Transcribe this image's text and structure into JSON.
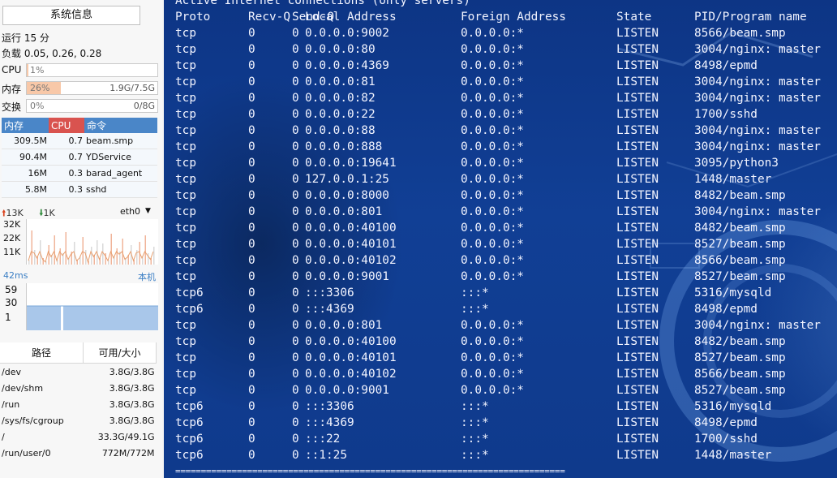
{
  "sidebar": {
    "title_button": "系统信息",
    "uptime": "运行 15 分",
    "load": "负载 0.05, 0.26, 0.28",
    "cpu": {
      "label": "CPU",
      "percent_text": "1%",
      "fill": 0.01,
      "amount": ""
    },
    "mem": {
      "label": "内存",
      "percent_text": "26%",
      "fill": 0.26,
      "amount": "1.9G/7.5G"
    },
    "swap": {
      "label": "交换",
      "percent_text": "0%",
      "fill": 0.0,
      "amount": "0/8G"
    },
    "proc_headers": {
      "mem": "内存",
      "cpu": "CPU",
      "cmd": "命令"
    },
    "processes": [
      {
        "mem": "309.5M",
        "cpu": "0.7",
        "cmd": "beam.smp"
      },
      {
        "mem": "90.4M",
        "cpu": "0.7",
        "cmd": "YDService"
      },
      {
        "mem": "16M",
        "cpu": "0.3",
        "cmd": "barad_agent"
      },
      {
        "mem": "5.8M",
        "cpu": "0.3",
        "cmd": "sshd"
      }
    ],
    "net": {
      "up": "13K",
      "down": "1K",
      "iface": "eth0",
      "y_labels": [
        "32K",
        "22K",
        "11K"
      ]
    },
    "ping": {
      "latency": "42ms",
      "host": "本机",
      "y_labels": [
        "59",
        "30",
        "1"
      ]
    },
    "disk_headers": {
      "path": "路径",
      "size": "可用/大小"
    },
    "disks": [
      {
        "path": "/dev",
        "size": "3.8G/3.8G"
      },
      {
        "path": "/dev/shm",
        "size": "3.8G/3.8G"
      },
      {
        "path": "/run",
        "size": "3.8G/3.8G"
      },
      {
        "path": "/sys/fs/cgroup",
        "size": "3.8G/3.8G"
      },
      {
        "path": "/",
        "size": "33.3G/49.1G"
      },
      {
        "path": "/run/user/0",
        "size": "772M/772M"
      }
    ]
  },
  "terminal": {
    "banner": "Active Internet connections (only servers)",
    "headers": {
      "proto": "Proto",
      "recvq": "Recv-Q",
      "sendq": "Send-Q",
      "local": "Local Address",
      "foreign": "Foreign Address",
      "state": "State",
      "pid": "PID/Program name"
    },
    "rows": [
      {
        "proto": "tcp",
        "recvq": "0",
        "sendq": "0",
        "local": "0.0.0.0:9002",
        "foreign": "0.0.0.0:*",
        "state": "LISTEN",
        "pid": "8566/beam.smp"
      },
      {
        "proto": "tcp",
        "recvq": "0",
        "sendq": "0",
        "local": "0.0.0.0:80",
        "foreign": "0.0.0.0:*",
        "state": "LISTEN",
        "pid": "3004/nginx: master"
      },
      {
        "proto": "tcp",
        "recvq": "0",
        "sendq": "0",
        "local": "0.0.0.0:4369",
        "foreign": "0.0.0.0:*",
        "state": "LISTEN",
        "pid": "8498/epmd"
      },
      {
        "proto": "tcp",
        "recvq": "0",
        "sendq": "0",
        "local": "0.0.0.0:81",
        "foreign": "0.0.0.0:*",
        "state": "LISTEN",
        "pid": "3004/nginx: master"
      },
      {
        "proto": "tcp",
        "recvq": "0",
        "sendq": "0",
        "local": "0.0.0.0:82",
        "foreign": "0.0.0.0:*",
        "state": "LISTEN",
        "pid": "3004/nginx: master"
      },
      {
        "proto": "tcp",
        "recvq": "0",
        "sendq": "0",
        "local": "0.0.0.0:22",
        "foreign": "0.0.0.0:*",
        "state": "LISTEN",
        "pid": "1700/sshd"
      },
      {
        "proto": "tcp",
        "recvq": "0",
        "sendq": "0",
        "local": "0.0.0.0:88",
        "foreign": "0.0.0.0:*",
        "state": "LISTEN",
        "pid": "3004/nginx: master"
      },
      {
        "proto": "tcp",
        "recvq": "0",
        "sendq": "0",
        "local": "0.0.0.0:888",
        "foreign": "0.0.0.0:*",
        "state": "LISTEN",
        "pid": "3004/nginx: master"
      },
      {
        "proto": "tcp",
        "recvq": "0",
        "sendq": "0",
        "local": "0.0.0.0:19641",
        "foreign": "0.0.0.0:*",
        "state": "LISTEN",
        "pid": "3095/python3"
      },
      {
        "proto": "tcp",
        "recvq": "0",
        "sendq": "0",
        "local": "127.0.0.1:25",
        "foreign": "0.0.0.0:*",
        "state": "LISTEN",
        "pid": "1448/master"
      },
      {
        "proto": "tcp",
        "recvq": "0",
        "sendq": "0",
        "local": "0.0.0.0:8000",
        "foreign": "0.0.0.0:*",
        "state": "LISTEN",
        "pid": "8482/beam.smp"
      },
      {
        "proto": "tcp",
        "recvq": "0",
        "sendq": "0",
        "local": "0.0.0.0:801",
        "foreign": "0.0.0.0:*",
        "state": "LISTEN",
        "pid": "3004/nginx: master"
      },
      {
        "proto": "tcp",
        "recvq": "0",
        "sendq": "0",
        "local": "0.0.0.0:40100",
        "foreign": "0.0.0.0:*",
        "state": "LISTEN",
        "pid": "8482/beam.smp"
      },
      {
        "proto": "tcp",
        "recvq": "0",
        "sendq": "0",
        "local": "0.0.0.0:40101",
        "foreign": "0.0.0.0:*",
        "state": "LISTEN",
        "pid": "8527/beam.smp"
      },
      {
        "proto": "tcp",
        "recvq": "0",
        "sendq": "0",
        "local": "0.0.0.0:40102",
        "foreign": "0.0.0.0:*",
        "state": "LISTEN",
        "pid": "8566/beam.smp"
      },
      {
        "proto": "tcp",
        "recvq": "0",
        "sendq": "0",
        "local": "0.0.0.0:9001",
        "foreign": "0.0.0.0:*",
        "state": "LISTEN",
        "pid": "8527/beam.smp"
      },
      {
        "proto": "tcp6",
        "recvq": "0",
        "sendq": "0",
        "local": ":::3306",
        "foreign": ":::*",
        "state": "LISTEN",
        "pid": "5316/mysqld"
      },
      {
        "proto": "tcp6",
        "recvq": "0",
        "sendq": "0",
        "local": ":::4369",
        "foreign": ":::*",
        "state": "LISTEN",
        "pid": "8498/epmd"
      },
      {
        "proto": "tcp",
        "recvq": "0",
        "sendq": "0",
        "local": "0.0.0.0:801",
        "foreign": "0.0.0.0:*",
        "state": "LISTEN",
        "pid": "3004/nginx: master"
      },
      {
        "proto": "tcp",
        "recvq": "0",
        "sendq": "0",
        "local": "0.0.0.0:40100",
        "foreign": "0.0.0.0:*",
        "state": "LISTEN",
        "pid": "8482/beam.smp"
      },
      {
        "proto": "tcp",
        "recvq": "0",
        "sendq": "0",
        "local": "0.0.0.0:40101",
        "foreign": "0.0.0.0:*",
        "state": "LISTEN",
        "pid": "8527/beam.smp"
      },
      {
        "proto": "tcp",
        "recvq": "0",
        "sendq": "0",
        "local": "0.0.0.0:40102",
        "foreign": "0.0.0.0:*",
        "state": "LISTEN",
        "pid": "8566/beam.smp"
      },
      {
        "proto": "tcp",
        "recvq": "0",
        "sendq": "0",
        "local": "0.0.0.0:9001",
        "foreign": "0.0.0.0:*",
        "state": "LISTEN",
        "pid": "8527/beam.smp"
      },
      {
        "proto": "tcp6",
        "recvq": "0",
        "sendq": "0",
        "local": ":::3306",
        "foreign": ":::*",
        "state": "LISTEN",
        "pid": "5316/mysqld"
      },
      {
        "proto": "tcp6",
        "recvq": "0",
        "sendq": "0",
        "local": ":::4369",
        "foreign": ":::*",
        "state": "LISTEN",
        "pid": "8498/epmd"
      },
      {
        "proto": "tcp6",
        "recvq": "0",
        "sendq": "0",
        "local": ":::22",
        "foreign": ":::*",
        "state": "LISTEN",
        "pid": "1700/sshd"
      },
      {
        "proto": "tcp6",
        "recvq": "0",
        "sendq": "0",
        "local": "::1:25",
        "foreign": ":::*",
        "state": "LISTEN",
        "pid": "1448/master"
      }
    ],
    "separator": "============================================================================"
  },
  "colors": {
    "proc_header_mem": "#4a86c8",
    "proc_header_cpu": "#d9534f",
    "proc_header_cmd": "#4a86c8",
    "meter_fill": "#f8c8a8",
    "up_arrow": "#d9431e",
    "down_arrow": "#2e8b3a",
    "chart_bars": "#f0b49a",
    "chart_line": "#e8a070",
    "ping_fill": "#a9c7ea",
    "terminal_bg": "#113f95"
  }
}
